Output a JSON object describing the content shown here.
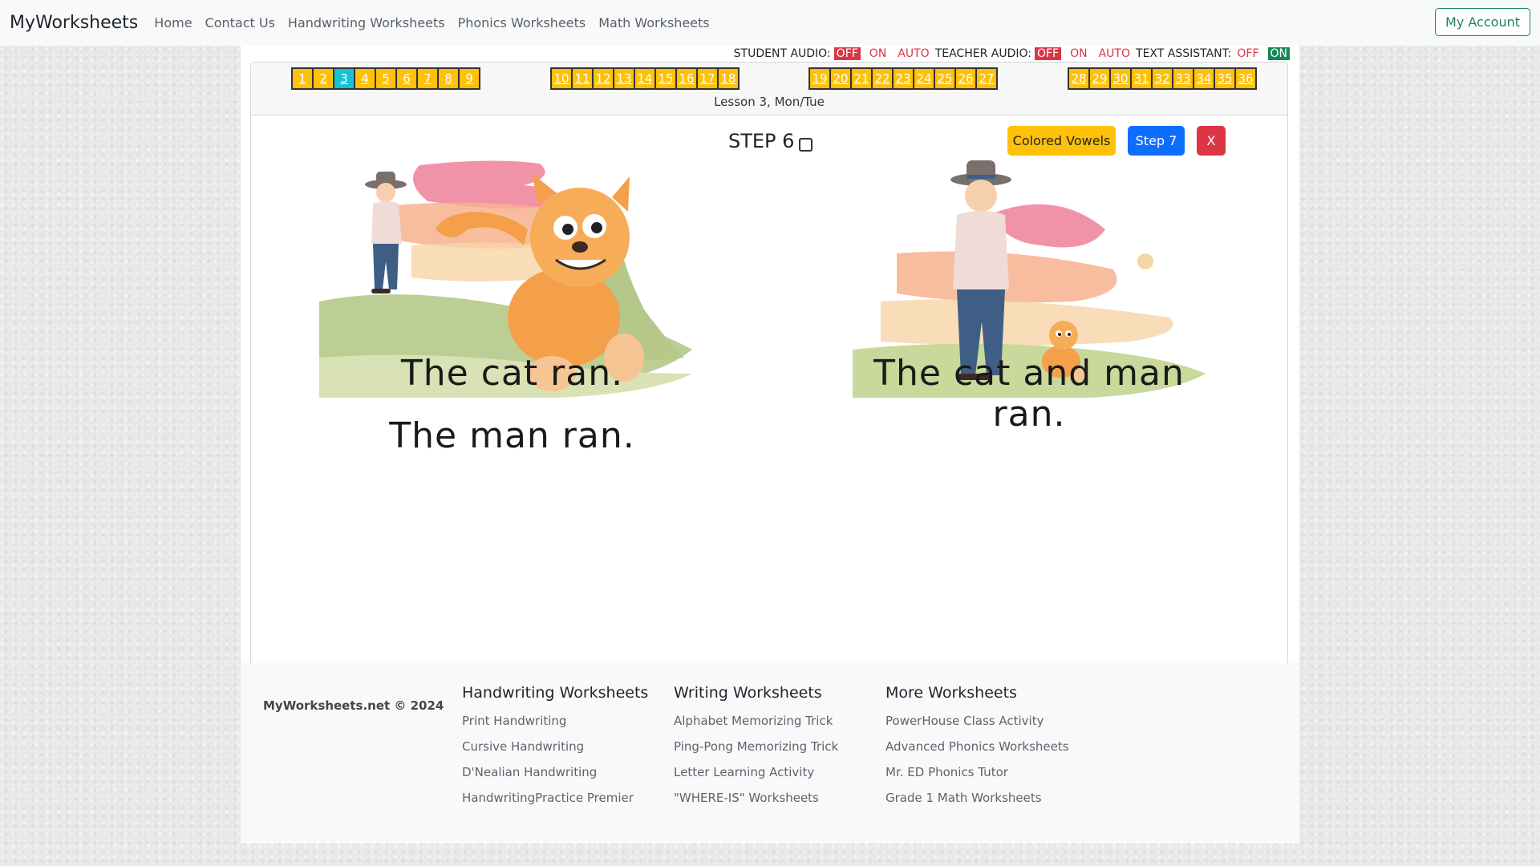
{
  "nav": {
    "brand": "MyWorksheets",
    "links": [
      "Home",
      "Contact Us",
      "Handwriting Worksheets",
      "Phonics Worksheets",
      "Math Worksheets"
    ],
    "account": "My Account"
  },
  "audio": {
    "student_label": "STUDENT AUDIO:",
    "teacher_label": "TEACHER AUDIO:",
    "assistant_label": "TEXT ASSISTANT:",
    "off": "OFF",
    "on": "ON",
    "auto": "AUTO"
  },
  "lessons": {
    "groups": [
      [
        "1",
        "2",
        "3",
        "4",
        "5",
        "6",
        "7",
        "8",
        "9"
      ],
      [
        "10",
        "11",
        "12",
        "13",
        "14",
        "15",
        "16",
        "17",
        "18"
      ],
      [
        "19",
        "20",
        "21",
        "22",
        "23",
        "24",
        "25",
        "26",
        "27"
      ],
      [
        "28",
        "29",
        "30",
        "31",
        "32",
        "33",
        "34",
        "35",
        "36"
      ]
    ],
    "current": "3",
    "title": "Lesson 3, Mon/Tue"
  },
  "step": {
    "label": "STEP 6"
  },
  "buttons": {
    "vowels": "Colored Vowels",
    "next": "Step 7",
    "close": "X"
  },
  "sentences": {
    "left_1": "The cat ran.",
    "left_2": "The man ran.",
    "right_1": "The cat and man ran."
  },
  "footer": {
    "copyright": "MyWorksheets.net © 2024",
    "col1": {
      "title": "Handwriting Worksheets",
      "items": [
        "Print Handwriting",
        "Cursive Handwriting",
        "D'Nealian Handwriting",
        "HandwritingPractice Premier"
      ]
    },
    "col2": {
      "title": "Writing Worksheets",
      "items": [
        "Alphabet Memorizing Trick",
        "Ping-Pong Memorizing Trick",
        "Letter Learning Activity",
        "\"WHERE-IS\" Worksheets"
      ]
    },
    "col3": {
      "title": "More Worksheets",
      "items": [
        "PowerHouse Class Activity",
        "Advanced Phonics Worksheets",
        "Mr. ED Phonics Tutor",
        "Grade 1 Math Worksheets"
      ]
    }
  },
  "colors": {
    "yellow": "#ffc107",
    "teal": "#17c1d4",
    "red": "#dc3545",
    "green": "#198754",
    "blue": "#0d6efd"
  }
}
